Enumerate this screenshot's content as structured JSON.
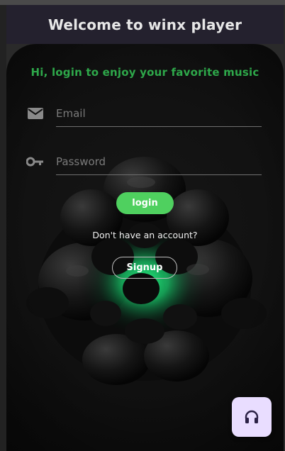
{
  "header": {
    "title": "Welcome to winx player"
  },
  "login": {
    "subtitle": "Hi, login to enjoy your favorite music",
    "email_placeholder": "Email",
    "email_value": "",
    "password_placeholder": "Password",
    "password_value": "",
    "login_label": "login",
    "no_account_text": "Don't have an account?",
    "signup_label": "Signup"
  },
  "icons": {
    "email": "mail-icon",
    "password": "key-icon",
    "fab": "headphones-icon"
  },
  "colors": {
    "accent_green": "#4fd05f",
    "subtitle_green": "#2ea84a",
    "header_bg": "#24212e",
    "fab_bg": "#e9ddff",
    "fab_icon": "#2b2145"
  }
}
